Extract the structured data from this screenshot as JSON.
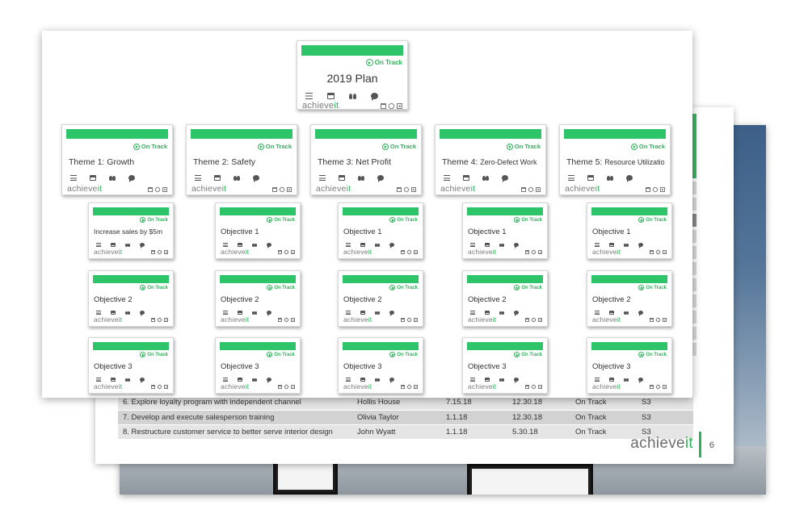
{
  "colors": {
    "accent_green": "#2ec46a",
    "status_green": "#2fb05a",
    "logo_gray": "#7a7a7a"
  },
  "brand": {
    "word": "achieve",
    "suffix": "it"
  },
  "status_label": "On Track",
  "plan": {
    "title": "2019 Plan"
  },
  "themes": [
    {
      "prefix": "Theme 1:",
      "name": "Growth"
    },
    {
      "prefix": "Theme 2:",
      "name": "Safety"
    },
    {
      "prefix": "Theme 3:",
      "name": "Net Profit"
    },
    {
      "prefix": "Theme 4:",
      "name": "Zero-Defect Work"
    },
    {
      "prefix": "Theme 5:",
      "name": "Resource Utilization"
    }
  ],
  "objectives": [
    [
      "Increase sales by $5m",
      "Objective 1",
      "Objective 1",
      "Objective 1",
      "Objective 1"
    ],
    [
      "Objective 2",
      "Objective 2",
      "Objective 2",
      "Objective 2",
      "Objective 2"
    ],
    [
      "Objective 3",
      "Objective 3",
      "Objective 3",
      "Objective 3",
      "Objective 3"
    ]
  ],
  "icons": {
    "card": [
      "list-icon",
      "calendar-icon",
      "people-icon",
      "chat-icon"
    ],
    "tools": [
      "trash-icon",
      "link-icon",
      "add-icon"
    ]
  },
  "table": {
    "rows": [
      {
        "task": "6. Explore loyalty program with independent channel",
        "owner": "Hollis House",
        "start": "7.15.18",
        "end": "12.30.18",
        "status": "On Track",
        "code": "S3"
      },
      {
        "task": "7. Develop and execute salesperson training",
        "owner": "Olivia Taylor",
        "start": "1.1.18",
        "end": "12.30.18",
        "status": "On Track",
        "code": "S3"
      },
      {
        "task": "8. Restructure customer service to better serve interior design",
        "owner": "John Wyatt",
        "start": "1.1.18",
        "end": "5.30.18",
        "status": "On Track",
        "code": "S3"
      }
    ]
  },
  "slide": {
    "page_number": "6"
  }
}
